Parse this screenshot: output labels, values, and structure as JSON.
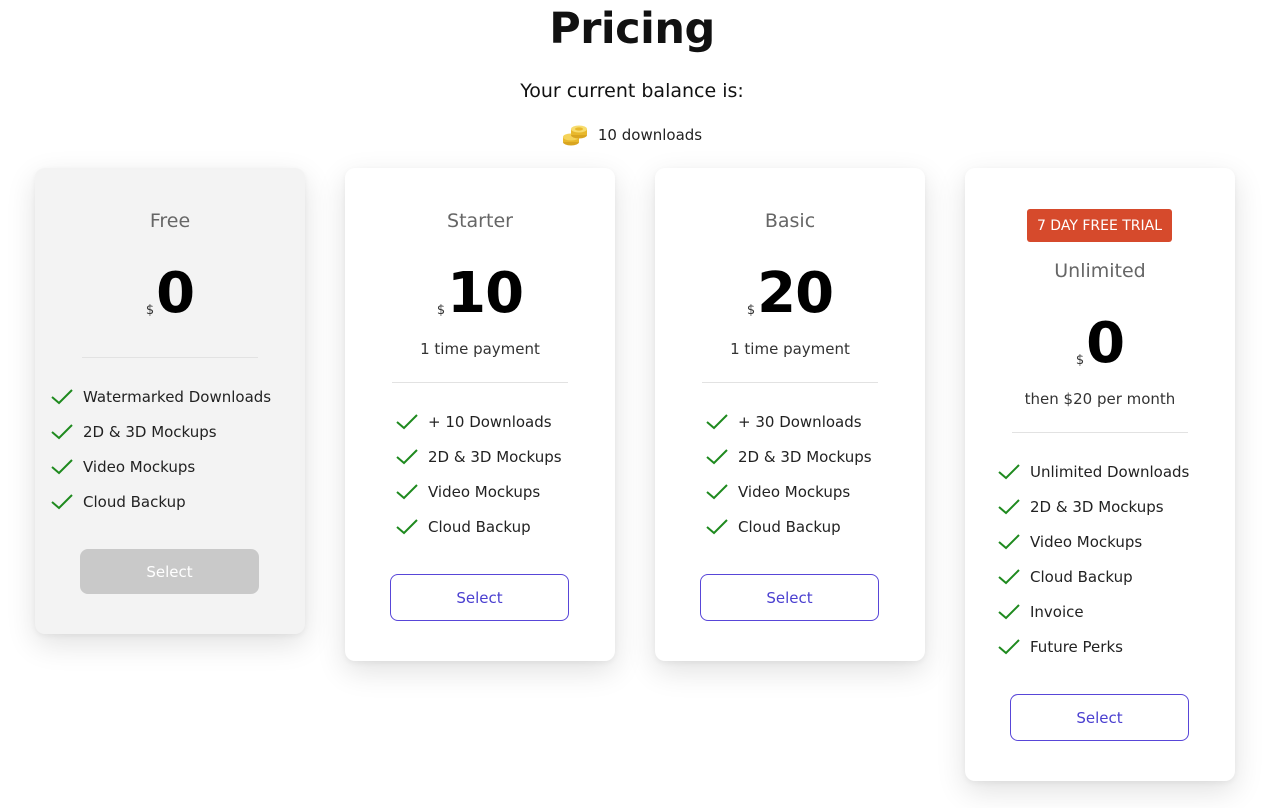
{
  "header": {
    "title": "Pricing",
    "balance_label": "Your current balance is:",
    "balance_value": "10 downloads"
  },
  "currency_symbol": "$",
  "plans": [
    {
      "name": "Free",
      "amount": "0",
      "features": [
        "Watermarked Downloads",
        "2D & 3D Mockups",
        "Video Mockups",
        "Cloud Backup"
      ],
      "button": "Select"
    },
    {
      "name": "Starter",
      "amount": "10",
      "note": "1 time payment",
      "features": [
        "+ 10 Downloads",
        "2D & 3D Mockups",
        "Video Mockups",
        "Cloud Backup"
      ],
      "button": "Select"
    },
    {
      "name": "Basic",
      "amount": "20",
      "note": "1 time payment",
      "features": [
        "+ 30 Downloads",
        "2D & 3D Mockups",
        "Video Mockups",
        "Cloud Backup"
      ],
      "button": "Select"
    },
    {
      "badge": "7 DAY FREE TRIAL",
      "name": "Unlimited",
      "amount": "0",
      "note": "then $20 per month",
      "features": [
        "Unlimited Downloads",
        "2D & 3D Mockups",
        "Video Mockups",
        "Cloud Backup",
        "Invoice",
        "Future Perks"
      ],
      "button": "Select"
    }
  ],
  "icons": {
    "balance": "coins-icon",
    "feature": "check-icon"
  },
  "colors": {
    "accent": "#4a3fd0",
    "check": "#1e8a1e",
    "badge": "#d64a2c",
    "disabled": "#c9c9c9"
  }
}
